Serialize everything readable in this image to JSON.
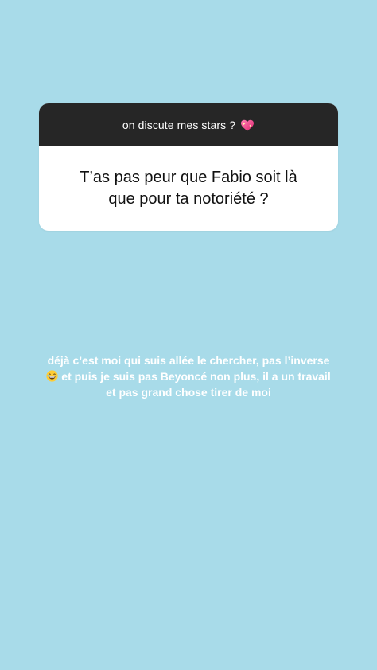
{
  "question": {
    "prompt": "on discute mes stars ?",
    "prompt_icon": "sparkling-heart-icon",
    "text_line1": "T’as pas peur que Fabio soit là",
    "text_line2": "que pour ta notoriété ?"
  },
  "caption": {
    "line1": "déjà c’est moi qui suis allée le chercher, pas l’inverse",
    "line2_icon": "laughing-face-icon",
    "line2": "et puis je suis pas Beyoncé non plus, il a un travail",
    "line3": "et pas grand chose tirer de moi"
  },
  "colors": {
    "background": "#a8dbe9",
    "header": "#262626",
    "card": "#ffffff",
    "caption_text": "#ffffff"
  }
}
